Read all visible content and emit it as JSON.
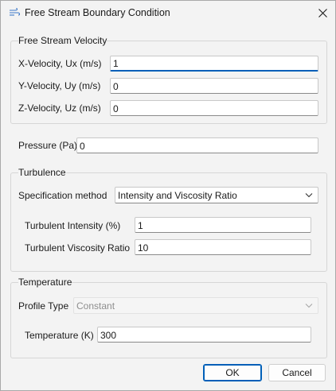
{
  "window": {
    "title": "Free Stream Boundary Condition"
  },
  "velocity": {
    "group_title": "Free Stream Velocity",
    "x_label": "X-Velocity, Ux (m/s)",
    "x_value": "1",
    "y_label": "Y-Velocity, Uy (m/s)",
    "y_value": "0",
    "z_label": "Z-Velocity, Uz (m/s)",
    "z_value": "0"
  },
  "pressure": {
    "label": "Pressure  (Pa)",
    "value": "0"
  },
  "turbulence": {
    "group_title": "Turbulence",
    "spec_label": "Specification method",
    "spec_value": "Intensity and Viscosity Ratio",
    "intensity_label": "Turbulent Intensity  (%)",
    "intensity_value": "1",
    "ratio_label": "Turbulent Viscosity Ratio",
    "ratio_value": "10"
  },
  "temperature": {
    "group_title": "Temperature",
    "profile_label": "Profile Type",
    "profile_value": "Constant",
    "temp_label": "Temperature  (K)",
    "temp_value": "300"
  },
  "buttons": {
    "ok": "OK",
    "cancel": "Cancel"
  },
  "icons": {
    "title": "wind-icon",
    "close": "close-icon",
    "dropdown": "chevron-down-icon"
  },
  "colors": {
    "accent": "#005fb8",
    "background": "#f3f3f3"
  }
}
